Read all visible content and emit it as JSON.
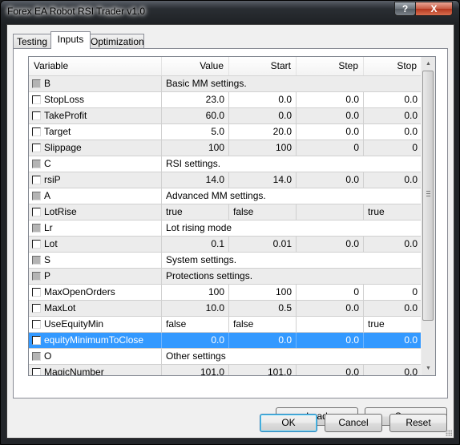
{
  "window": {
    "title": "Forex EA Robot RSI Trader v1.0",
    "help_label": "?",
    "close_label": "X"
  },
  "tabs": [
    {
      "label": "Testing",
      "active": false
    },
    {
      "label": "Inputs",
      "active": true
    },
    {
      "label": "Optimization",
      "active": false
    }
  ],
  "grid": {
    "columns": [
      "Variable",
      "Value",
      "Start",
      "Step",
      "Stop"
    ],
    "rows": [
      {
        "type": "group",
        "name": "B",
        "description": "Basic MM settings."
      },
      {
        "type": "param",
        "name": "StopLoss",
        "value": "23.0",
        "start": "0.0",
        "step": "0.0",
        "stop": "0.0"
      },
      {
        "type": "param",
        "name": "TakeProfit",
        "value": "60.0",
        "start": "0.0",
        "step": "0.0",
        "stop": "0.0"
      },
      {
        "type": "param",
        "name": "Target",
        "value": "5.0",
        "start": "20.0",
        "step": "0.0",
        "stop": "0.0"
      },
      {
        "type": "param",
        "name": "Slippage",
        "value": "100",
        "start": "100",
        "step": "0",
        "stop": "0"
      },
      {
        "type": "group",
        "name": "C",
        "description": "RSI settings."
      },
      {
        "type": "param",
        "name": "rsiP",
        "value": "14.0",
        "start": "14.0",
        "step": "0.0",
        "stop": "0.0"
      },
      {
        "type": "group",
        "name": "A",
        "description": "Advanced MM settings."
      },
      {
        "type": "bool",
        "name": "LotRise",
        "value": "true",
        "start": "false",
        "step": "",
        "stop": "true"
      },
      {
        "type": "group",
        "name": "Lr",
        "description": "Lot rising mode"
      },
      {
        "type": "param",
        "name": "Lot",
        "value": "0.1",
        "start": "0.01",
        "step": "0.0",
        "stop": "0.0"
      },
      {
        "type": "group",
        "name": "S",
        "description": "System settings."
      },
      {
        "type": "group",
        "name": "P",
        "description": "Protections settings."
      },
      {
        "type": "param",
        "name": "MaxOpenOrders",
        "value": "100",
        "start": "100",
        "step": "0",
        "stop": "0"
      },
      {
        "type": "param",
        "name": "MaxLot",
        "value": "10.0",
        "start": "0.5",
        "step": "0.0",
        "stop": "0.0"
      },
      {
        "type": "bool",
        "name": "UseEquityMin",
        "value": "false",
        "start": "false",
        "step": "",
        "stop": "true"
      },
      {
        "type": "param",
        "name": "equityMinimumToClose",
        "value": "0.0",
        "start": "0.0",
        "step": "0.0",
        "stop": "0.0",
        "selected": true
      },
      {
        "type": "group",
        "name": "O",
        "description": "Other settings"
      },
      {
        "type": "param",
        "name": "MagicNumber",
        "value": "101.0",
        "start": "101.0",
        "step": "0.0",
        "stop": "0.0"
      }
    ]
  },
  "buttons": {
    "load": {
      "prefix": "",
      "mnemonic": "L",
      "rest": "oad"
    },
    "save": {
      "prefix": "",
      "mnemonic": "S",
      "rest": "ave"
    },
    "ok": "OK",
    "cancel": "Cancel",
    "reset": "Reset"
  },
  "colors": {
    "selection": "#3399ff",
    "row_alt": "#ececec"
  }
}
